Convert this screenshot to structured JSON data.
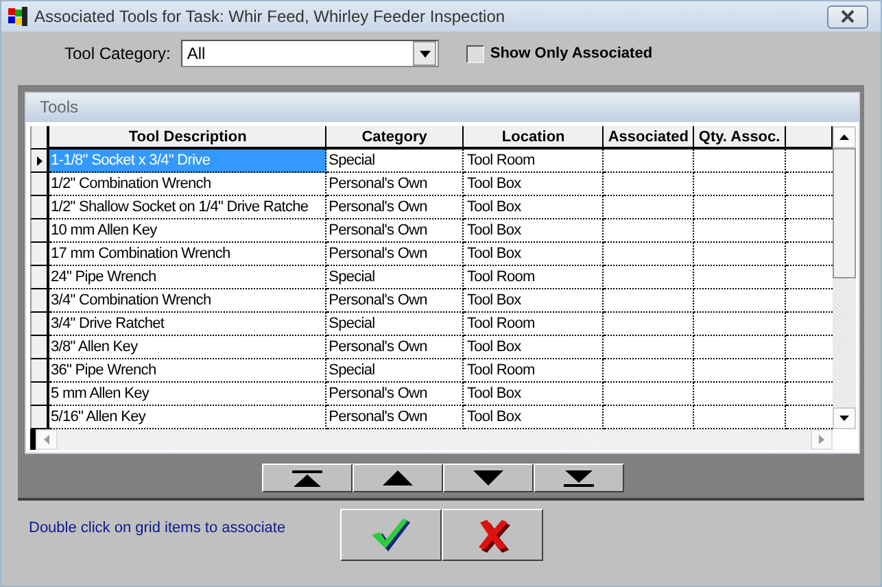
{
  "window": {
    "title": "Associated Tools for Task: Whir Feed, Whirley Feeder Inspection"
  },
  "filter": {
    "label": "Tool Category:",
    "value": "All"
  },
  "show_only_associated": {
    "label": "Show Only Associated",
    "checked": false
  },
  "grid": {
    "title": "Tools",
    "columns": [
      "Tool Description",
      "Category",
      "Location",
      "Associated",
      "Qty. Assoc."
    ],
    "rows": [
      {
        "cells": [
          "1-1/8\" Socket x 3/4\" Drive",
          "Special",
          "Tool Room",
          "",
          ""
        ],
        "selected": true
      },
      {
        "cells": [
          "1/2\" Combination Wrench",
          "Personal's Own",
          "Tool Box",
          "",
          ""
        ],
        "selected": false
      },
      {
        "cells": [
          "1/2\" Shallow Socket on 1/4\" Drive Ratche",
          "Personal's Own",
          "Tool Box",
          "",
          ""
        ],
        "selected": false
      },
      {
        "cells": [
          "10 mm Allen Key",
          "Personal's Own",
          "Tool Box",
          "",
          ""
        ],
        "selected": false
      },
      {
        "cells": [
          "17 mm Combination Wrench",
          "Personal's Own",
          "Tool Box",
          "",
          ""
        ],
        "selected": false
      },
      {
        "cells": [
          "24\" Pipe Wrench",
          "Special",
          "Tool Room",
          "",
          ""
        ],
        "selected": false
      },
      {
        "cells": [
          "3/4\" Combination Wrench",
          "Personal's Own",
          "Tool Box",
          "",
          ""
        ],
        "selected": false
      },
      {
        "cells": [
          "3/4\" Drive Ratchet",
          "Special",
          "Tool Room",
          "",
          ""
        ],
        "selected": false
      },
      {
        "cells": [
          "3/8\" Allen Key",
          "Personal's Own",
          "Tool Box",
          "",
          ""
        ],
        "selected": false
      },
      {
        "cells": [
          "36\" Pipe Wrench",
          "Special",
          "Tool Room",
          "",
          ""
        ],
        "selected": false
      },
      {
        "cells": [
          "5 mm Allen Key",
          "Personal's Own",
          "Tool Box",
          "",
          ""
        ],
        "selected": false
      },
      {
        "cells": [
          "5/16\" Allen Key",
          "Personal's Own",
          "Tool Box",
          "",
          ""
        ],
        "selected": false
      }
    ]
  },
  "hint": "Double click on grid items to associate"
}
